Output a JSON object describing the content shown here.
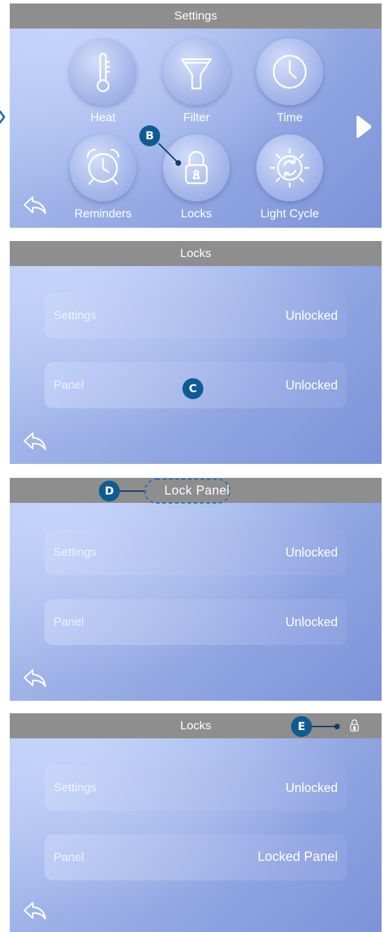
{
  "screen1": {
    "title": "Settings",
    "items": [
      {
        "label": "Heat",
        "icon": "thermometer-icon"
      },
      {
        "label": "Filter",
        "icon": "filter-funnel-icon"
      },
      {
        "label": "Time",
        "icon": "clock-icon"
      },
      {
        "label": "Reminders",
        "icon": "alarm-clock-icon"
      },
      {
        "label": "Locks",
        "icon": "padlock-icon"
      },
      {
        "label": "Light Cycle",
        "icon": "light-cycle-icon"
      }
    ],
    "next_icon": "play-arrow-icon",
    "back_icon": "back-arrow-icon"
  },
  "screen2": {
    "title": "Locks",
    "rows": [
      {
        "label": "Settings",
        "value": "Unlocked"
      },
      {
        "label": "Panel",
        "value": "Unlocked"
      }
    ]
  },
  "screen3": {
    "title": "Lock Panel",
    "rows": [
      {
        "label": "Settings",
        "value": "Unlocked"
      },
      {
        "label": "Panel",
        "value": "Unlocked"
      }
    ]
  },
  "screen4": {
    "title": "Locks",
    "status_icon": "small-lock-icon",
    "rows": [
      {
        "label": "Settings",
        "value": "Unlocked"
      },
      {
        "label": "Panel",
        "value": "Locked Panel"
      }
    ]
  },
  "callouts": {
    "b": "B",
    "c": "C",
    "d": "D",
    "e": "E"
  },
  "colors": {
    "titlebar": "#8e8e8e",
    "panel_light": "#c6d5fa",
    "panel_dark": "#7c93d8",
    "callout": "#0f5c93",
    "callout_outline": "#2f6fb0"
  }
}
